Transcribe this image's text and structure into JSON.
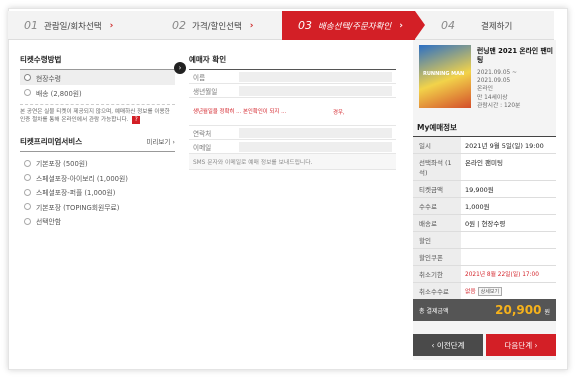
{
  "steps": [
    {
      "num": "01",
      "label": "관람일/회차선택",
      "arrow": "›"
    },
    {
      "num": "02",
      "label": "가격/할인선택",
      "arrow": "›"
    },
    {
      "num": "03",
      "label": "배송선택/주문자확인",
      "arrow": "›"
    },
    {
      "num": "04",
      "label": "결제하기",
      "arrow": ""
    }
  ],
  "ticket": {
    "title": "티켓수령방법",
    "options": [
      "현장수령",
      "배송 (2,800원)"
    ],
    "notice": "본 공연은 실물 티켓이 제공되지 않으며, 예매하신 정보를 이용한 인증 절차를 통해 온라인에서 관람 가능합니다.",
    "q_icon": "?"
  },
  "service": {
    "title": "티켓프리미엄서비스",
    "more": "미리보기 ›",
    "options": [
      "기본포장 (500원)",
      "스페셜포장-아이보리 (1,000원)",
      "스페셜포장-퍼플 (1,000원)",
      "기본포장 (TOPING회원무료)",
      "선택안함"
    ]
  },
  "booker": {
    "title": "예매자 확인",
    "arrow_icon": "›",
    "fields": [
      "이름",
      "생년월일"
    ],
    "warning_left": "생년월일을 정확히 ... 본인확인이 되지 ...",
    "warning_right": "경우,",
    "fields2": [
      "연락처",
      "이메일"
    ],
    "sms": "SMS 문자와 이메일로 예매 정보를 보내드립니다."
  },
  "summary": {
    "perf_title": "런닝맨 2021 온라인 팬미팅",
    "poster_text": "RUNNING MAN",
    "perf_meta": [
      "2021.09.05 ~",
      "2021.09.05",
      "온라인",
      "만 14세이상",
      "관람시간 : 120분"
    ],
    "my_title": "My예매정보",
    "rows": [
      {
        "k": "일시",
        "v": "2021년 9월 5일(일) 19:00"
      },
      {
        "k": "선택좌석 (1석)",
        "v": "온라인 팬미팅"
      },
      {
        "k": "티켓금액",
        "v": "19,900원"
      },
      {
        "k": "수수료",
        "v": "1,000원"
      },
      {
        "k": "배송료",
        "v": "0원 | 현장수령"
      },
      {
        "k": "할인",
        "v": ""
      },
      {
        "k": "할인쿠폰",
        "v": ""
      },
      {
        "k": "취소기한",
        "v": "2021년 8월 22일(일) 17:00"
      },
      {
        "k": "취소수수료",
        "v": "없음",
        "btn": "상세보기"
      }
    ],
    "total_label": "총 결제금액",
    "total_value": "20,900",
    "total_unit": "원",
    "prev_label": "‹ 이전단계",
    "next_label": "다음단계 ›"
  },
  "colors": {
    "accent": "#d31f26",
    "total_value": "#f6b21b"
  }
}
